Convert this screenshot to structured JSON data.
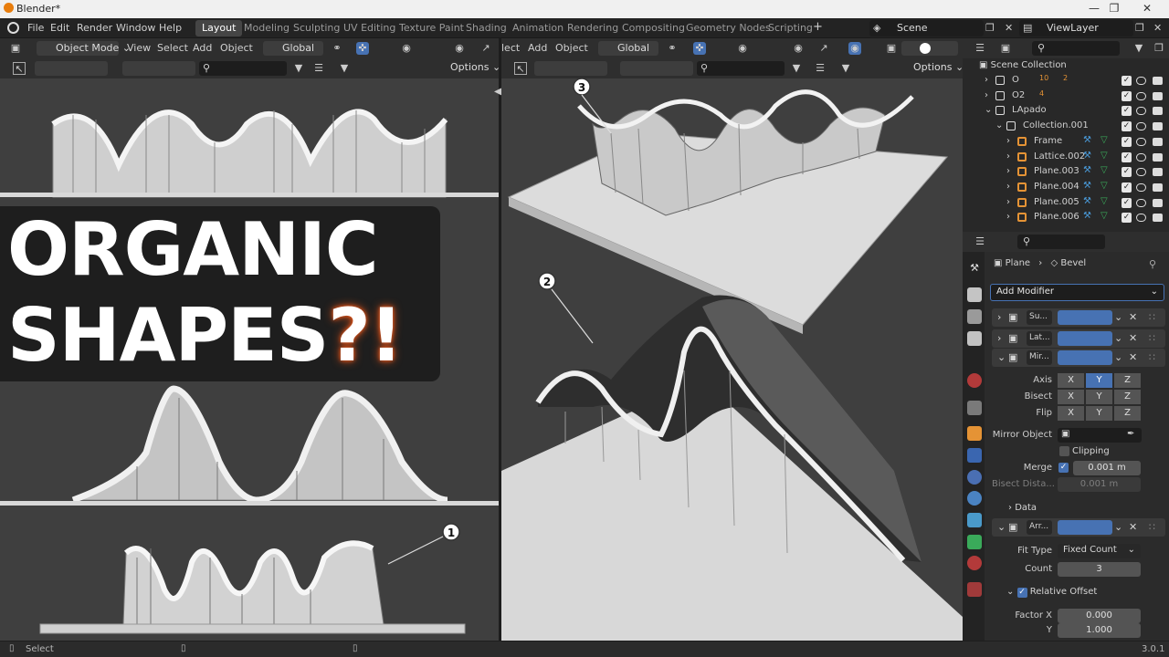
{
  "app": {
    "title": "Blender*",
    "version": "3.0.1"
  },
  "menu": [
    "File",
    "Edit",
    "Render",
    "Window",
    "Help"
  ],
  "workspaces": [
    "Layout",
    "Modeling",
    "Sculpting",
    "UV Editing",
    "Texture Paint",
    "Shading",
    "Animation",
    "Rendering",
    "Compositing",
    "Geometry Nodes",
    "Scripting"
  ],
  "active_workspace": "Layout",
  "scene": {
    "name": "Scene",
    "view_layer": "ViewLayer"
  },
  "left_viewport_header": {
    "mode": "Object Mode",
    "view": "View",
    "select": "Select",
    "add": "Add",
    "object": "Object",
    "transform": "Global",
    "options": "Options"
  },
  "right_viewport_header": {
    "select_trunc": "lect",
    "add": "Add",
    "object": "Object",
    "transform": "Global",
    "options": "Options"
  },
  "overlay": {
    "line1": "ORGANIC",
    "line2": "SHAPES",
    "punct": "?!"
  },
  "markers": [
    "1",
    "2",
    "3"
  ],
  "outliner": {
    "root": "Scene Collection",
    "items": [
      {
        "name": "O",
        "badge1": "10",
        "badge2": "2",
        "indent": 0
      },
      {
        "name": "O2",
        "badge1": "4",
        "indent": 0
      },
      {
        "name": "LApado",
        "indent": 0
      },
      {
        "name": "Collection.001",
        "indent": 1
      },
      {
        "name": "Frame",
        "indent": 2
      },
      {
        "name": "Lattice.002",
        "indent": 2
      },
      {
        "name": "Plane.003",
        "indent": 2
      },
      {
        "name": "Plane.004",
        "indent": 2
      },
      {
        "name": "Plane.005",
        "indent": 2
      },
      {
        "name": "Plane.006",
        "indent": 2
      }
    ]
  },
  "properties": {
    "breadcrumb_object": "Plane",
    "breadcrumb_modifier": "Bevel",
    "add_modifier": "Add Modifier",
    "modifiers": [
      "Su...",
      "Lat...",
      "Mir...",
      "Arr..."
    ],
    "mirror": {
      "axis_label": "Axis",
      "bisect_label": "Bisect",
      "flip_label": "Flip",
      "axes": [
        "X",
        "Y",
        "Z"
      ],
      "active_axis": "Y",
      "mirror_object_label": "Mirror Object",
      "clipping_label": "Clipping",
      "merge_label": "Merge",
      "merge_value": "0.001 m",
      "bisect_distance_label": "Bisect Dista...",
      "bisect_distance_value": "0.001 m",
      "data_label": "Data"
    },
    "array": {
      "fit_type_label": "Fit Type",
      "fit_type_value": "Fixed Count",
      "count_label": "Count",
      "count_value": "3",
      "relative_offset_label": "Relative Offset",
      "factor_x_label": "Factor X",
      "factor_x_value": "0.000",
      "y_label": "Y",
      "y_value": "1.000"
    }
  },
  "status": {
    "select": "Select"
  },
  "colors": {
    "accent": "#4772b3",
    "orange": "#e59335",
    "viewport": "#3f3f3f",
    "panel": "#2e2e2e"
  }
}
